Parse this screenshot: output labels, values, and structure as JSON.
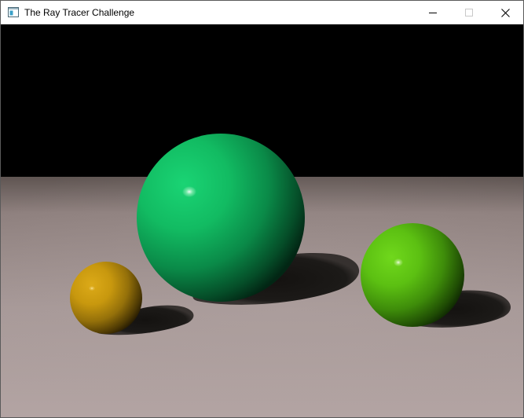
{
  "window": {
    "title": "The Ray Tracer Challenge",
    "app_icon": "window-app-icon",
    "controls": {
      "minimize_icon": "minimize-icon",
      "maximize_icon": "maximize-icon",
      "close_icon": "close-icon"
    }
  },
  "scene": {
    "background_color": "#000000",
    "floor_color_near": "#b3a4a3",
    "floor_color_far": "#5f5552",
    "spheres": [
      {
        "name": "middle-sphere",
        "color": "#14c864"
      },
      {
        "name": "right-sphere",
        "color": "#66cc14"
      },
      {
        "name": "left-sphere",
        "color": "#d4a414"
      }
    ]
  }
}
